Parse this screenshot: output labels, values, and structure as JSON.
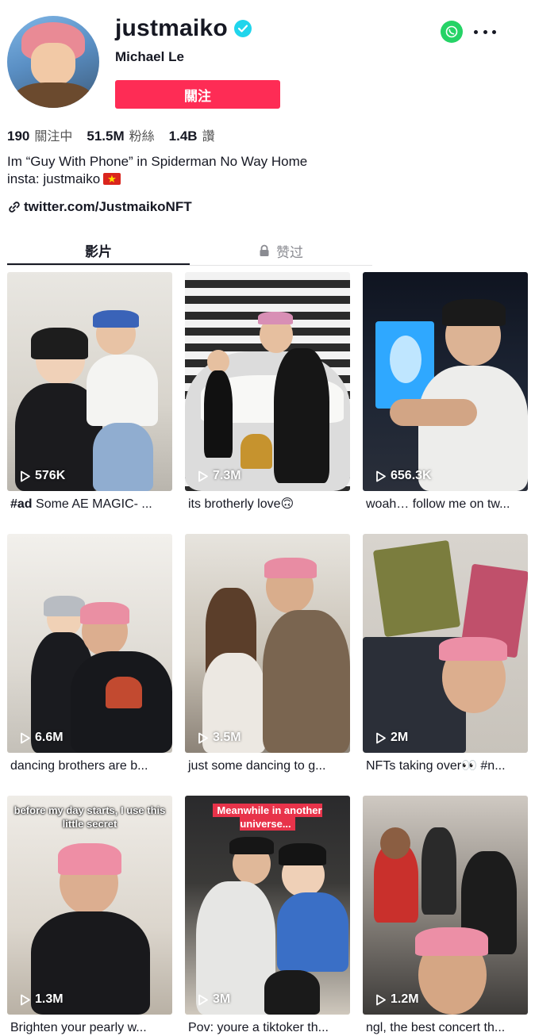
{
  "profile": {
    "username": "justmaiko",
    "nickname": "Michael Le",
    "follow_label": "關注",
    "stats": [
      {
        "value": "190",
        "label": "關注中"
      },
      {
        "value": "51.5M",
        "label": "粉絲"
      },
      {
        "value": "1.4B",
        "label": "讚"
      }
    ],
    "bio_line1": "Im “Guy With Phone” in Spiderman No Way Home",
    "bio_line2": "insta: justmaiko",
    "link": "twitter.com/JustmaikoNFT"
  },
  "tabs": {
    "videos": "影片",
    "liked": "赞过"
  },
  "icons": {
    "verified": "verified-badge-icon",
    "whatsapp": "whatsapp-icon",
    "more": "more-icon",
    "link": "link-icon",
    "lock": "lock-icon",
    "play": "play-icon",
    "flag": "vietnam-flag"
  },
  "colors": {
    "accent": "#fe2c55",
    "verified": "#20d5ec",
    "whatsapp": "#25d366"
  },
  "videos": [
    {
      "views": "576K",
      "caption_tag": "#ad",
      "caption": " Some AE MAGIC- ...",
      "overlay": ""
    },
    {
      "views": "7.3M",
      "caption_tag": "",
      "caption": "its brotherly love🙃",
      "overlay": ""
    },
    {
      "views": "656.3K",
      "caption_tag": "",
      "caption": "woah… follow me on tw...",
      "overlay": ""
    },
    {
      "views": "6.6M",
      "caption_tag": "",
      "caption": "dancing brothers are b...",
      "overlay": ""
    },
    {
      "views": "3.5M",
      "caption_tag": "",
      "caption": "just some dancing to g...",
      "overlay": ""
    },
    {
      "views": "2M",
      "caption_tag": "",
      "caption": "NFTs taking over👀 #n...",
      "overlay": ""
    },
    {
      "views": "1.3M",
      "caption_tag": "",
      "caption": "Brighten your pearly w...",
      "overlay": "before my day starts, I use this little secret"
    },
    {
      "views": "3M",
      "caption_tag": "",
      "caption": "Pov: youre a tiktoker th...",
      "overlay": "Meanwhile in another universe..."
    },
    {
      "views": "1.2M",
      "caption_tag": "",
      "caption": "ngl, the best concert th...",
      "overlay": ""
    }
  ]
}
